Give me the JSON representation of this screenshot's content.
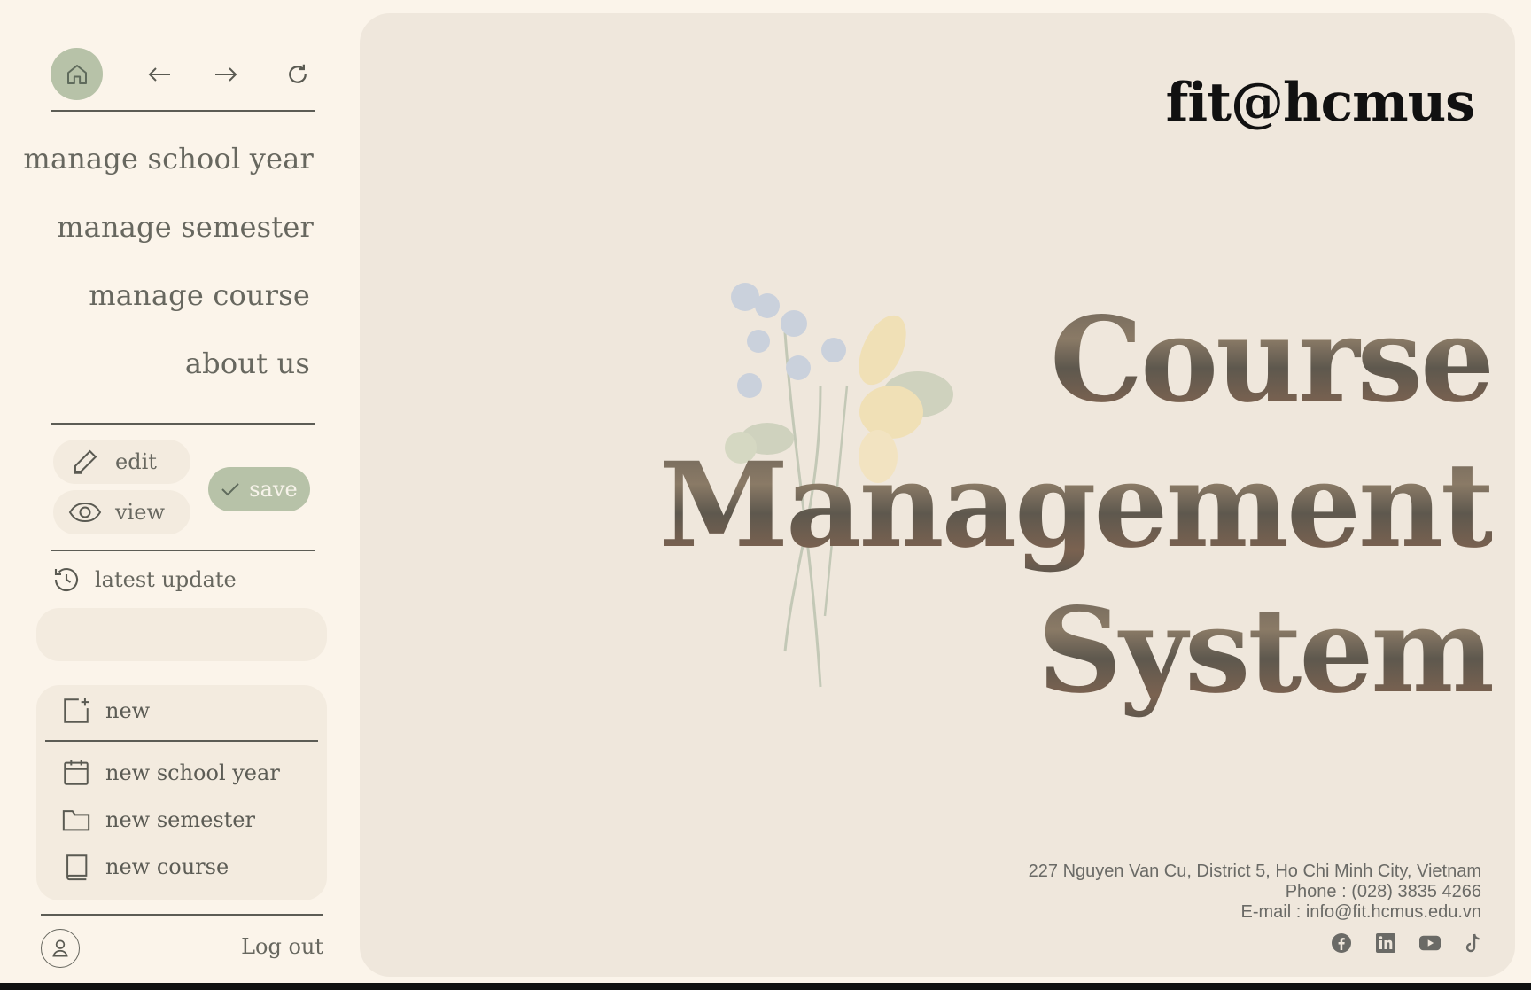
{
  "nav": {
    "icons": [
      "home-icon",
      "arrow-left-icon",
      "arrow-right-icon",
      "refresh-icon"
    ],
    "accent": "#b7c2a8"
  },
  "menu": {
    "items": [
      {
        "label": "manage school year"
      },
      {
        "label": "manage semester"
      },
      {
        "label": "manage course"
      },
      {
        "label": "about us"
      }
    ]
  },
  "actions": {
    "edit_label": "edit",
    "view_label": "view",
    "save_label": "save"
  },
  "latest": {
    "label": "latest update"
  },
  "new_panel": {
    "header": "new",
    "items": [
      {
        "label": "new school year",
        "icon": "calendar-icon"
      },
      {
        "label": "new semester",
        "icon": "folder-icon"
      },
      {
        "label": "new course",
        "icon": "book-icon"
      }
    ]
  },
  "account": {
    "logout_label": "Log out"
  },
  "main": {
    "brand": "fit@hcmus",
    "title_lines": [
      "Course",
      "Management",
      "System"
    ],
    "footer": {
      "address": "227 Nguyen Van Cu, District 5, Ho Chi Minh City, Vietnam",
      "phone": "Phone : (028) 3835 4266",
      "email": "E-mail : info@fit.hcmus.edu.vn"
    },
    "social_icons": [
      "facebook-icon",
      "linkedin-icon",
      "youtube-icon",
      "tiktok-icon"
    ]
  }
}
